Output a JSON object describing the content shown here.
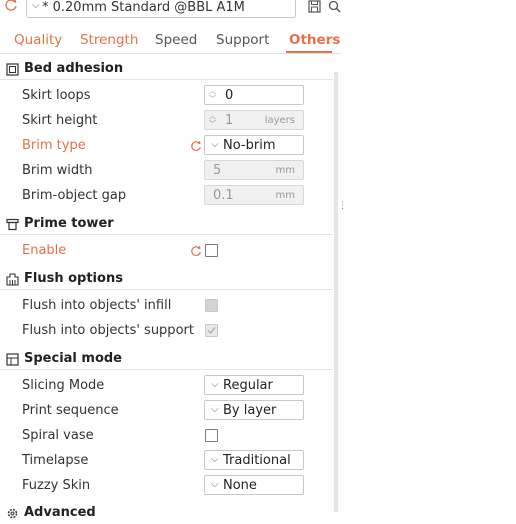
{
  "preset": {
    "name": "* 0.20mm Standard @BBL A1M"
  },
  "tabs": [
    {
      "label": "Quality"
    },
    {
      "label": "Strength"
    },
    {
      "label": "Speed"
    },
    {
      "label": "Support"
    },
    {
      "label": "Others"
    }
  ],
  "bed_adhesion": {
    "title": "Bed adhesion",
    "skirt_loops": {
      "label": "Skirt loops",
      "value": "0"
    },
    "skirt_height": {
      "label": "Skirt height",
      "value": "1",
      "unit": "layers"
    },
    "brim_type": {
      "label": "Brim type",
      "value": "No-brim"
    },
    "brim_width": {
      "label": "Brim width",
      "value": "5",
      "unit": "mm"
    },
    "brim_gap": {
      "label": "Brim-object gap",
      "value": "0.1",
      "unit": "mm"
    }
  },
  "prime_tower": {
    "title": "Prime tower",
    "enable": {
      "label": "Enable",
      "checked": false
    }
  },
  "flush_options": {
    "title": "Flush options",
    "infill": {
      "label": "Flush into objects' infill",
      "checked": false
    },
    "support": {
      "label": "Flush into objects' support",
      "checked": true
    }
  },
  "special_mode": {
    "title": "Special mode",
    "slicing_mode": {
      "label": "Slicing Mode",
      "value": "Regular"
    },
    "print_sequence": {
      "label": "Print sequence",
      "value": "By layer"
    },
    "spiral_vase": {
      "label": "Spiral vase",
      "checked": false
    },
    "timelapse": {
      "label": "Timelapse",
      "value": "Traditional"
    },
    "fuzzy_skin": {
      "label": "Fuzzy Skin",
      "value": "None"
    }
  },
  "advanced": {
    "title": "Advanced"
  },
  "colors": {
    "accent": "#e8704a",
    "text": "#333333",
    "border": "#c8c8c8"
  }
}
